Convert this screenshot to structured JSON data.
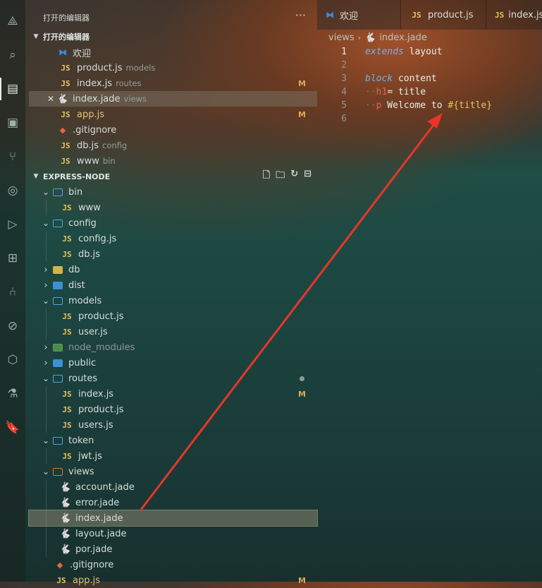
{
  "activity_icons": [
    "vscode-logo-icon",
    "search-icon",
    "book-icon",
    "package-icon",
    "source-control-icon",
    "remote-icon",
    "run-debug-icon",
    "extensions-icon",
    "git-graph-icon",
    "git-lens-icon",
    "cube-icon",
    "test-icon",
    "bookmark-icon"
  ],
  "open_editors": {
    "title": "打开的编辑器",
    "more": "···",
    "section": "打开的编辑器",
    "items": [
      {
        "icon": "vs",
        "name": "欢迎",
        "desc": ""
      },
      {
        "icon": "js",
        "name": "product.js",
        "desc": "models"
      },
      {
        "icon": "js",
        "name": "index.js",
        "desc": "routes",
        "badge": "M"
      },
      {
        "icon": "jade",
        "name": "index.jade",
        "desc": "views"
      },
      {
        "icon": "js",
        "name": "app.js",
        "desc": "",
        "badge": "M"
      },
      {
        "icon": "git",
        "name": ".gitignore",
        "desc": ""
      },
      {
        "icon": "js",
        "name": "db.js",
        "desc": "config"
      },
      {
        "icon": "js",
        "name": "www",
        "desc": "bin"
      }
    ]
  },
  "explorer": {
    "section": "EXPRESS-NODE",
    "tree": [
      {
        "type": "folder",
        "name": "bin",
        "open": true,
        "depth": 1
      },
      {
        "type": "js",
        "name": "www",
        "depth": 2
      },
      {
        "type": "folder",
        "name": "config",
        "open": true,
        "depth": 1
      },
      {
        "type": "js",
        "name": "config.js",
        "depth": 2
      },
      {
        "type": "js",
        "name": "db.js",
        "depth": 2
      },
      {
        "type": "folder-db",
        "name": "db",
        "open": false,
        "depth": 1
      },
      {
        "type": "folder-filled",
        "name": "dist",
        "open": false,
        "depth": 1
      },
      {
        "type": "folder",
        "name": "models",
        "open": true,
        "depth": 1
      },
      {
        "type": "js",
        "name": "product.js",
        "depth": 2
      },
      {
        "type": "js",
        "name": "user.js",
        "depth": 2
      },
      {
        "type": "folder-nm",
        "name": "node_modules",
        "open": false,
        "depth": 1,
        "dim": true
      },
      {
        "type": "folder-filled",
        "name": "public",
        "open": false,
        "depth": 1
      },
      {
        "type": "folder",
        "name": "routes",
        "open": true,
        "depth": 1,
        "modified": "dot"
      },
      {
        "type": "js",
        "name": "index.js",
        "depth": 2,
        "badge": "M"
      },
      {
        "type": "js",
        "name": "product.js",
        "depth": 2
      },
      {
        "type": "js",
        "name": "users.js",
        "depth": 2
      },
      {
        "type": "folder",
        "name": "token",
        "open": true,
        "depth": 1
      },
      {
        "type": "js",
        "name": "jwt.js",
        "depth": 2
      },
      {
        "type": "folder-views",
        "name": "views",
        "open": true,
        "depth": 1
      },
      {
        "type": "jade",
        "name": "account.jade",
        "depth": 2
      },
      {
        "type": "jade",
        "name": "error.jade",
        "depth": 2
      },
      {
        "type": "jade",
        "name": "index.jade",
        "depth": 2,
        "active": true
      },
      {
        "type": "jade",
        "name": "layout.jade",
        "depth": 2
      },
      {
        "type": "jade",
        "name": "por.jade",
        "depth": 2
      },
      {
        "type": "git",
        "name": ".gitignore",
        "depth": 1
      },
      {
        "type": "js",
        "name": "app.js",
        "depth": 1,
        "badge": "M"
      }
    ]
  },
  "tabs": [
    {
      "icon": "vs",
      "label": "欢迎"
    },
    {
      "icon": "js",
      "label": "product.js"
    },
    {
      "icon": "js",
      "label": "index.js"
    }
  ],
  "breadcrumb": {
    "folder": "views",
    "file": "index.jade"
  },
  "code": {
    "lines": [
      "1",
      "2",
      "3",
      "4",
      "5",
      "6"
    ],
    "l1_kw": "extends",
    "l1_rest": " layout",
    "l3_kw": "block",
    "l3_rest": " content",
    "l4_tag": "h1",
    "l4_rest": "= title",
    "l5_tag": "p",
    "l5_rest": " Welcome to ",
    "l5_interp": "#{title}"
  },
  "js_glyph": "JS",
  "jade_glyph": "🐇",
  "badge_m": "M"
}
